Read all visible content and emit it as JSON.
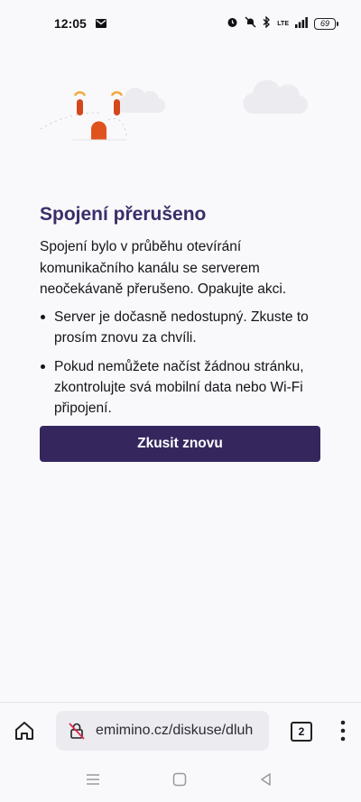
{
  "status_bar": {
    "time": "12:05",
    "network": "LTE",
    "battery": "69"
  },
  "error": {
    "title": "Spojení přerušeno",
    "description": "Spojení bylo v průběhu otevírání komunikačního kanálu se serverem neočekávaně přerušeno. Opakujte akci.",
    "bullets": [
      "Server je dočasně nedostupný. Zkuste to prosím znovu za chvíli.",
      "Pokud nemůžete načíst žádnou stránku, zkontrolujte svá mobilní data nebo Wi-Fi připojení."
    ],
    "retry_label": "Zkusit znovu"
  },
  "toolbar": {
    "url": "emimino.cz/diskuse/dluh",
    "tab_count": "2",
    "icons": [
      "home-icon",
      "insecure-lock-icon",
      "tabs-icon",
      "menu-icon"
    ]
  },
  "colors": {
    "title": "#3a2d6b",
    "button": "#35275e",
    "accent_orange": "#e8531f"
  }
}
